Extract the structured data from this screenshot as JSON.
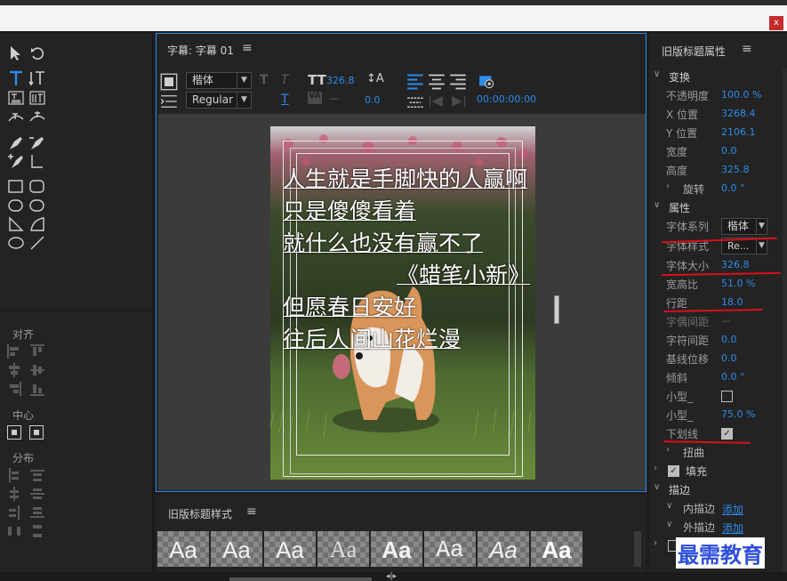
{
  "window": {
    "close_label": "x"
  },
  "title_panel": {
    "tab_label": "字幕: 字幕 01",
    "font_family": "楷体",
    "font_style": "Regular",
    "font_size": "326.8",
    "kerning": "0.0",
    "timecode": "00:00:00:00",
    "dash": "—"
  },
  "caption": {
    "lines": [
      "人生就是手脚快的人赢啊",
      "只是傻傻看着",
      "就什么也没有赢不了",
      "《蜡笔小新》",
      "但愿春日安好",
      "往后人间山花烂漫"
    ]
  },
  "tools_panel": {
    "align_label": "对齐",
    "center_label": "中心",
    "distribute_label": "分布"
  },
  "styles_panel": {
    "title": "旧版标题样式",
    "swatches": [
      "Aa",
      "Aa",
      "Aa",
      "Aa",
      "Aa",
      "Aa",
      "Aa",
      "Aa"
    ]
  },
  "props": {
    "title": "旧版标题属性",
    "sec_transform": "变换",
    "opacity_label": "不透明度",
    "opacity": "100.0 %",
    "xpos_label": "X 位置",
    "xpos": "3268.4",
    "ypos_label": "Y 位置",
    "ypos": "2106.1",
    "width_label": "宽度",
    "width": "0.0",
    "height_label": "高度",
    "height": "325.8",
    "rotate_label": "旋转",
    "rotate": "0.0 °",
    "sec_props": "属性",
    "font_family_label": "字体系列",
    "font_family": "楷体",
    "font_style_label": "字体样式",
    "font_style": "Re...",
    "font_size_label": "字体大小",
    "font_size": "326.8",
    "aspect_label": "宽高比",
    "aspect": "51.0 %",
    "leading_label": "行距",
    "leading": "18.0",
    "kerning_label": "字偶间距",
    "kerning": "—",
    "tracking_label": "字符间距",
    "tracking": "0.0",
    "baseline_label": "基线位移",
    "baseline": "0.0",
    "slant_label": "倾斜",
    "slant": "0.0 °",
    "smallcaps_label": "小型_",
    "smallcaps_size_label": "小型_",
    "smallcaps_size": "75.0 %",
    "underline_label": "下划线",
    "distort_label": "扭曲",
    "fill_label": "填充",
    "stroke_label": "描边",
    "inner_stroke_label": "内描边",
    "inner_stroke": "添加",
    "outer_stroke_label": "外描边",
    "outer_stroke": "添加"
  },
  "watermark": "最需教育",
  "colors": {
    "accent": "#2d8ceb",
    "highlight": "#d9101c"
  }
}
